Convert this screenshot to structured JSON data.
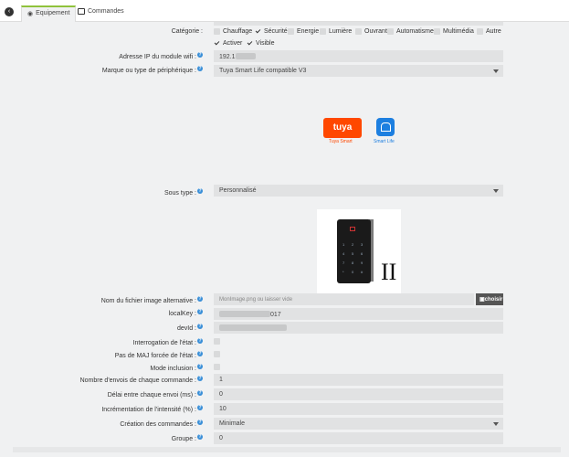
{
  "tabs": {
    "equipement": "Equipement",
    "commandes": "Commandes"
  },
  "form": {
    "categorie_label": "Catégorie :",
    "categories": [
      {
        "label": "Chauffage",
        "checked": false
      },
      {
        "label": "Sécurité",
        "checked": true
      },
      {
        "label": "Energie",
        "checked": false
      },
      {
        "label": "Lumière",
        "checked": false
      },
      {
        "label": "Ouvrant",
        "checked": false
      },
      {
        "label": "Automatisme",
        "checked": false
      },
      {
        "label": "Multimédia",
        "checked": false
      },
      {
        "label": "Autre",
        "checked": false
      }
    ],
    "activer_label": "Activer",
    "visible_label": "Visible",
    "ip_label": "Adresse IP du module wifi :",
    "ip_value": "192.1",
    "marque_label": "Marque ou type de périphérique :",
    "marque_value": "Tuya Smart Life compatible V3",
    "tuya_caption": "Tuya Smart",
    "tuya_text": "tuya",
    "smartlife_caption": "Smart Life",
    "sous_type_label": "Sous type :",
    "sous_type_value": "Personnalisé",
    "roman_numeral": "II",
    "image_label": "Nom du fichier image alternative :",
    "image_placeholder": "MonImage.png ou laisser vide",
    "choisir_label": "choisir",
    "localkey_label": "localKey :",
    "localkey_value": "017",
    "devid_label": "devId :",
    "interrogation_label": "Interrogation de l'état :",
    "pas_maj_label": "Pas de MAJ forcée de l'état :",
    "mode_inclusion_label": "Mode inclusion :",
    "nb_envois_label": "Nombre d'envois de chaque commande :",
    "nb_envois_value": "1",
    "delai_label": "Délai entre chaque envoi (ms) :",
    "delai_value": "0",
    "increment_label": "Incrémentation de l'intensité (%) :",
    "increment_value": "10",
    "creation_label": "Création des commandes :",
    "creation_value": "Minimale",
    "groupe_label": "Groupe :",
    "groupe_value": "0"
  },
  "colors": {
    "accent": "#8fc23b",
    "help": "#3a8fd8",
    "tuya": "#ff4800",
    "smartlife": "#1d7fe0"
  },
  "icons": [
    "back-arrow-icon",
    "tachometer-icon",
    "list-icon",
    "help-icon",
    "check-icon",
    "chevron-down-icon",
    "camera-icon"
  ]
}
